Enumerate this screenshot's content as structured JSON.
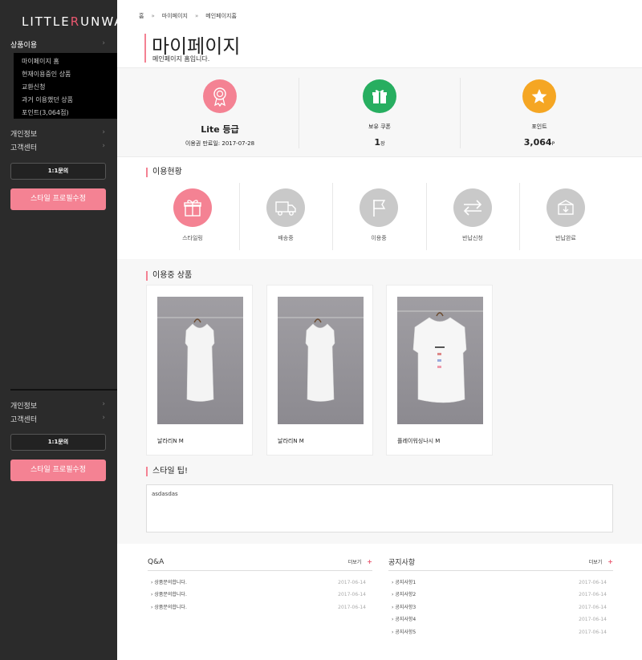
{
  "logo": {
    "part1": "LITTLE",
    "part2": "R",
    "part3": "UNWAY"
  },
  "sidebar": {
    "top_menu": {
      "label": "상품이용"
    },
    "submenu": [
      "마이페이지 홈",
      "현재이용중인 상품",
      "교환신청",
      "과거 이용했던 상품",
      "포인트(3,064점)"
    ],
    "menu1": [
      {
        "label": "개인정보"
      },
      {
        "label": "고객센터"
      }
    ],
    "qa_button": "1:1문의",
    "style_button": "스타일 프로필수정",
    "menu2": [
      {
        "label": "개인정보"
      },
      {
        "label": "고객센터"
      }
    ],
    "qa_button2": "1:1문의",
    "style_button2": "스타일 프로필수정"
  },
  "breadcrumb": [
    "홈",
    "마이페이지",
    "메인페이지홈"
  ],
  "page": {
    "title": "마이페이지",
    "subtitle": "메인페이지 홈입니다."
  },
  "stats": {
    "grade": {
      "label": "Lite 등급",
      "expire": "이용권 만료일: 2017-07-28",
      "color": "#f48293"
    },
    "coupon": {
      "label": "보유 쿠폰",
      "value": "1",
      "unit": "장",
      "color": "#27ae60"
    },
    "point": {
      "label": "포인트",
      "value": "3,064",
      "unit": "P",
      "color": "#f5a623"
    }
  },
  "usage": {
    "title": "이용현황",
    "items": [
      {
        "label": "스타일링",
        "icon": "gift-icon",
        "active": true
      },
      {
        "label": "배송중",
        "icon": "truck-icon",
        "active": false
      },
      {
        "label": "이용중",
        "icon": "flag-icon",
        "active": false
      },
      {
        "label": "반납신청",
        "icon": "exchange-icon",
        "active": false
      },
      {
        "label": "반납완료",
        "icon": "box-icon",
        "active": false
      }
    ]
  },
  "products": {
    "title": "이용중 상품",
    "items": [
      {
        "name": "날라리N M"
      },
      {
        "name": "날라리N M"
      },
      {
        "name": "플레이워싱나시 M"
      }
    ]
  },
  "style_tip": {
    "title": "스타일 팁!",
    "text": "asdasdas"
  },
  "qna": {
    "title": "Q&A",
    "more": "더보기",
    "rows": [
      {
        "text": "상품문의합니다.",
        "date": "2017-06-14"
      },
      {
        "text": "상품문의합니다.",
        "date": "2017-06-14"
      },
      {
        "text": "상품문의합니다.",
        "date": "2017-06-14"
      }
    ]
  },
  "notice": {
    "title": "공지사항",
    "more": "더보기",
    "rows": [
      {
        "text": "공지사항1",
        "date": "2017-06-14"
      },
      {
        "text": "공지사항2",
        "date": "2017-06-14"
      },
      {
        "text": "공지사항3",
        "date": "2017-06-14"
      },
      {
        "text": "공지사항4",
        "date": "2017-06-14"
      },
      {
        "text": "공지사항5",
        "date": "2017-06-14"
      }
    ]
  }
}
